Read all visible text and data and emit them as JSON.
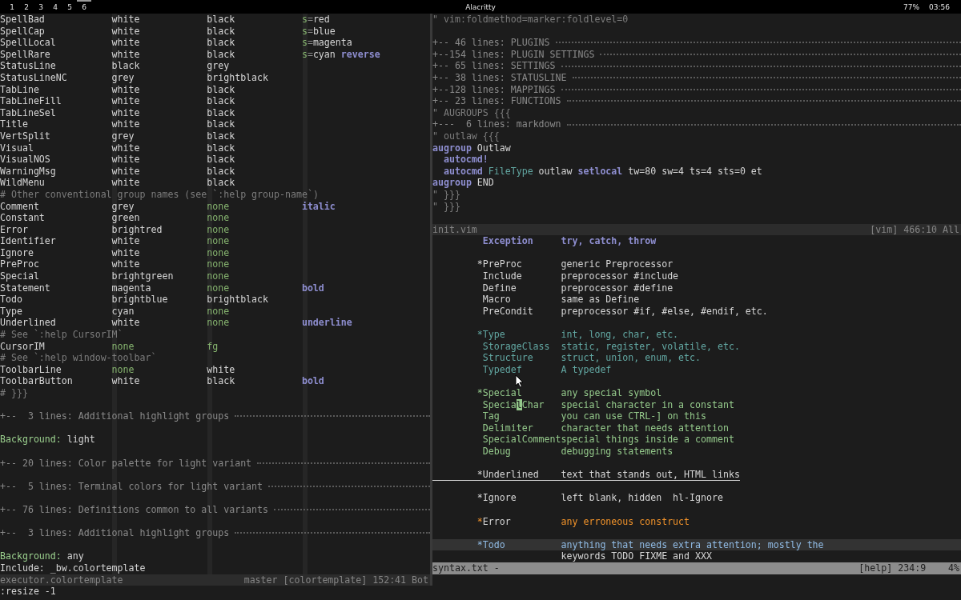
{
  "top_bar": {
    "workspaces": [
      {
        "label": "1",
        "selected": false
      },
      {
        "label": "2",
        "selected": false
      },
      {
        "label": "3",
        "selected": false
      },
      {
        "label": "4",
        "selected": false
      },
      {
        "label": "5",
        "selected": false
      },
      {
        "label": "6",
        "selected": true
      }
    ],
    "title": "Alacritty",
    "battery": "77%",
    "clock": "03:56"
  },
  "left_pane": {
    "lines": [
      {
        "kind": "entry",
        "cells": [
          [
            {
              "text": "SpellBad",
              "kind": "normal"
            }
          ],
          [
            {
              "text": "white",
              "kind": "normal"
            }
          ],
          [
            {
              "text": "black",
              "kind": "normal"
            }
          ],
          [
            {
              "text": "s",
              "kind": "constant"
            },
            {
              "text": "=",
              "kind": "operator",
              "attached": true
            },
            {
              "text": "red",
              "kind": "normal",
              "attached": true
            }
          ]
        ]
      },
      {
        "kind": "entry",
        "cells": [
          [
            {
              "text": "SpellCap",
              "kind": "normal"
            }
          ],
          [
            {
              "text": "white",
              "kind": "normal"
            }
          ],
          [
            {
              "text": "black",
              "kind": "normal"
            }
          ],
          [
            {
              "text": "s",
              "kind": "constant"
            },
            {
              "text": "=",
              "kind": "operator",
              "attached": true
            },
            {
              "text": "blue",
              "kind": "normal",
              "attached": true
            }
          ]
        ]
      },
      {
        "kind": "entry",
        "cells": [
          [
            {
              "text": "SpellLocal",
              "kind": "normal"
            }
          ],
          [
            {
              "text": "white",
              "kind": "normal"
            }
          ],
          [
            {
              "text": "black",
              "kind": "normal"
            }
          ],
          [
            {
              "text": "s",
              "kind": "constant"
            },
            {
              "text": "=",
              "kind": "operator",
              "attached": true
            },
            {
              "text": "magenta",
              "kind": "normal",
              "attached": true
            }
          ]
        ]
      },
      {
        "kind": "entry",
        "cells": [
          [
            {
              "text": "SpellRare",
              "kind": "normal"
            }
          ],
          [
            {
              "text": "white",
              "kind": "normal"
            }
          ],
          [
            {
              "text": "black",
              "kind": "normal"
            }
          ],
          [
            {
              "text": "s",
              "kind": "constant"
            },
            {
              "text": "=",
              "kind": "operator",
              "attached": true
            },
            {
              "text": "cyan",
              "kind": "normal",
              "attached": true
            },
            {
              "text": "reverse",
              "kind": "statement"
            }
          ]
        ]
      },
      {
        "kind": "entry",
        "cells": [
          [
            {
              "text": "StatusLine",
              "kind": "normal"
            }
          ],
          [
            {
              "text": "black",
              "kind": "normal"
            }
          ],
          [
            {
              "text": "grey",
              "kind": "normal"
            }
          ]
        ]
      },
      {
        "kind": "entry",
        "cells": [
          [
            {
              "text": "StatusLineNC",
              "kind": "normal"
            }
          ],
          [
            {
              "text": "grey",
              "kind": "normal"
            }
          ],
          [
            {
              "text": "brightblack",
              "kind": "normal"
            }
          ]
        ]
      },
      {
        "kind": "entry",
        "cells": [
          [
            {
              "text": "TabLine",
              "kind": "normal"
            }
          ],
          [
            {
              "text": "white",
              "kind": "normal"
            }
          ],
          [
            {
              "text": "black",
              "kind": "normal"
            }
          ]
        ]
      },
      {
        "kind": "entry",
        "cells": [
          [
            {
              "text": "TabLineFill",
              "kind": "normal"
            }
          ],
          [
            {
              "text": "white",
              "kind": "normal"
            }
          ],
          [
            {
              "text": "black",
              "kind": "normal"
            }
          ]
        ]
      },
      {
        "kind": "entry",
        "cells": [
          [
            {
              "text": "TabLineSel",
              "kind": "normal"
            }
          ],
          [
            {
              "text": "white",
              "kind": "normal"
            }
          ],
          [
            {
              "text": "black",
              "kind": "normal"
            }
          ]
        ]
      },
      {
        "kind": "entry",
        "cells": [
          [
            {
              "text": "Title",
              "kind": "normal"
            }
          ],
          [
            {
              "text": "white",
              "kind": "normal"
            }
          ],
          [
            {
              "text": "black",
              "kind": "normal"
            }
          ]
        ]
      },
      {
        "kind": "entry",
        "cells": [
          [
            {
              "text": "VertSplit",
              "kind": "normal"
            }
          ],
          [
            {
              "text": "grey",
              "kind": "normal"
            }
          ],
          [
            {
              "text": "black",
              "kind": "normal"
            }
          ]
        ]
      },
      {
        "kind": "entry",
        "cells": [
          [
            {
              "text": "Visual",
              "kind": "normal"
            }
          ],
          [
            {
              "text": "white",
              "kind": "normal"
            }
          ],
          [
            {
              "text": "black",
              "kind": "normal"
            }
          ]
        ]
      },
      {
        "kind": "entry",
        "cells": [
          [
            {
              "text": "VisualNOS",
              "kind": "normal"
            }
          ],
          [
            {
              "text": "white",
              "kind": "normal"
            }
          ],
          [
            {
              "text": "black",
              "kind": "normal"
            }
          ]
        ]
      },
      {
        "kind": "entry",
        "cells": [
          [
            {
              "text": "WarningMsg",
              "kind": "normal"
            }
          ],
          [
            {
              "text": "white",
              "kind": "normal"
            }
          ],
          [
            {
              "text": "black",
              "kind": "normal"
            }
          ]
        ]
      },
      {
        "kind": "entry",
        "cells": [
          [
            {
              "text": "WildMenu",
              "kind": "normal"
            }
          ],
          [
            {
              "text": "white",
              "kind": "normal"
            }
          ],
          [
            {
              "text": "black",
              "kind": "normal"
            }
          ]
        ]
      },
      {
        "kind": "comment",
        "text": "# Other conventional group names (see `:help group-name`)"
      },
      {
        "kind": "entry",
        "cells": [
          [
            {
              "text": "Comment",
              "kind": "normal"
            }
          ],
          [
            {
              "text": "grey",
              "kind": "normal"
            }
          ],
          [
            {
              "text": "none",
              "kind": "constant"
            }
          ],
          [
            {
              "text": "italic",
              "kind": "statement"
            }
          ]
        ]
      },
      {
        "kind": "entry",
        "cells": [
          [
            {
              "text": "Constant",
              "kind": "normal"
            }
          ],
          [
            {
              "text": "green",
              "kind": "normal"
            }
          ],
          [
            {
              "text": "none",
              "kind": "constant"
            }
          ]
        ]
      },
      {
        "kind": "entry",
        "cells": [
          [
            {
              "text": "Error",
              "kind": "normal"
            }
          ],
          [
            {
              "text": "brightred",
              "kind": "normal"
            }
          ],
          [
            {
              "text": "none",
              "kind": "constant"
            }
          ]
        ]
      },
      {
        "kind": "entry",
        "cells": [
          [
            {
              "text": "Identifier",
              "kind": "normal"
            }
          ],
          [
            {
              "text": "white",
              "kind": "normal"
            }
          ],
          [
            {
              "text": "none",
              "kind": "constant"
            }
          ]
        ]
      },
      {
        "kind": "entry",
        "cells": [
          [
            {
              "text": "Ignore",
              "kind": "normal"
            }
          ],
          [
            {
              "text": "white",
              "kind": "normal"
            }
          ],
          [
            {
              "text": "none",
              "kind": "constant"
            }
          ]
        ]
      },
      {
        "kind": "entry",
        "cells": [
          [
            {
              "text": "PreProc",
              "kind": "normal"
            }
          ],
          [
            {
              "text": "white",
              "kind": "normal"
            }
          ],
          [
            {
              "text": "none",
              "kind": "constant"
            }
          ]
        ]
      },
      {
        "kind": "entry",
        "cells": [
          [
            {
              "text": "Special",
              "kind": "normal"
            }
          ],
          [
            {
              "text": "brightgreen",
              "kind": "normal"
            }
          ],
          [
            {
              "text": "none",
              "kind": "constant"
            }
          ]
        ]
      },
      {
        "kind": "entry",
        "cells": [
          [
            {
              "text": "Statement",
              "kind": "normal"
            }
          ],
          [
            {
              "text": "magenta",
              "kind": "normal"
            }
          ],
          [
            {
              "text": "none",
              "kind": "constant"
            }
          ],
          [
            {
              "text": "bold",
              "kind": "statement"
            }
          ]
        ]
      },
      {
        "kind": "entry",
        "cells": [
          [
            {
              "text": "Todo",
              "kind": "normal"
            }
          ],
          [
            {
              "text": "brightblue",
              "kind": "normal"
            }
          ],
          [
            {
              "text": "brightblack",
              "kind": "normal"
            }
          ]
        ]
      },
      {
        "kind": "entry",
        "cells": [
          [
            {
              "text": "Type",
              "kind": "normal"
            }
          ],
          [
            {
              "text": "cyan",
              "kind": "normal"
            }
          ],
          [
            {
              "text": "none",
              "kind": "constant"
            }
          ]
        ]
      },
      {
        "kind": "entry",
        "cells": [
          [
            {
              "text": "Underlined",
              "kind": "normal"
            }
          ],
          [
            {
              "text": "white",
              "kind": "normal"
            }
          ],
          [
            {
              "text": "none",
              "kind": "constant"
            }
          ],
          [
            {
              "text": "underline",
              "kind": "statement"
            }
          ]
        ]
      },
      {
        "kind": "comment",
        "text": "# See `:help CursorIM`"
      },
      {
        "kind": "entry",
        "cells": [
          [
            {
              "text": "CursorIM",
              "kind": "normal"
            }
          ],
          [
            {
              "text": "none",
              "kind": "constant"
            }
          ],
          [
            {
              "text": "fg",
              "kind": "constant"
            }
          ]
        ]
      },
      {
        "kind": "comment",
        "text": "# See `:help window-toolbar`"
      },
      {
        "kind": "entry",
        "cells": [
          [
            {
              "text": "ToolbarLine",
              "kind": "normal"
            }
          ],
          [
            {
              "text": "none",
              "kind": "constant"
            }
          ],
          [
            {
              "text": "white",
              "kind": "normal"
            }
          ]
        ]
      },
      {
        "kind": "entry",
        "cells": [
          [
            {
              "text": "ToolbarButton",
              "kind": "normal"
            }
          ],
          [
            {
              "text": "white",
              "kind": "normal"
            }
          ],
          [
            {
              "text": "black",
              "kind": "normal"
            }
          ],
          [
            {
              "text": "bold",
              "kind": "statement"
            }
          ]
        ]
      },
      {
        "kind": "comment",
        "text": "# }}}"
      },
      {
        "kind": "blank"
      },
      {
        "kind": "fold",
        "text": "+--  3 lines: Additional highlight groups"
      },
      {
        "kind": "blank"
      },
      {
        "kind": "setting",
        "key": "Background:",
        "value": "light"
      },
      {
        "kind": "blank"
      },
      {
        "kind": "fold",
        "text": "+-- 20 lines: Color palette for light variant"
      },
      {
        "kind": "blank"
      },
      {
        "kind": "fold",
        "text": "+--  5 lines: Terminal colors for light variant"
      },
      {
        "kind": "blank"
      },
      {
        "kind": "fold",
        "text": "+-- 76 lines: Definitions common to all variants"
      },
      {
        "kind": "blank"
      },
      {
        "kind": "fold",
        "text": "+--  3 lines: Additional highlight groups"
      },
      {
        "kind": "blank"
      },
      {
        "kind": "setting",
        "key": "Background:",
        "value": "any"
      },
      {
        "kind": "plain",
        "text": "Include: _bw.colortemplate"
      }
    ],
    "status_line": {
      "file": "executor.colortemplate",
      "info": "master [colortemplate] 152:41 Bot",
      "active": false
    }
  },
  "top_right_pane": {
    "lines": [
      {
        "kind": "comment",
        "text": "\" vim:foldmethod=marker:foldlevel=0"
      },
      {
        "kind": "blank"
      },
      {
        "kind": "fold",
        "text": "+-- 46 lines: PLUGINS"
      },
      {
        "kind": "fold",
        "text": "+--154 lines: PLUGIN SETTINGS"
      },
      {
        "kind": "fold",
        "text": "+-- 65 lines: SETTINGS"
      },
      {
        "kind": "fold",
        "text": "+-- 38 lines: STATUSLINE"
      },
      {
        "kind": "fold",
        "text": "+--128 lines: MAPPINGS"
      },
      {
        "kind": "fold",
        "text": "+-- 23 lines: FUNCTIONS"
      },
      {
        "kind": "comment",
        "text": "\" AUGROUPS {{{"
      },
      {
        "kind": "fold",
        "text": "+---  6 lines: markdown"
      },
      {
        "kind": "comment",
        "text": "\" outlaw {{{"
      },
      {
        "kind": "code",
        "tokens": [
          {
            "text": "augroup",
            "kind": "statement"
          },
          {
            "text": "Outlaw",
            "kind": "normal"
          }
        ],
        "children": [
          {
            "kind": "code",
            "tokens": [
              {
                "text": "autocmd!",
                "kind": "statement"
              }
            ]
          },
          {
            "kind": "code",
            "tokens": [
              {
                "text": "autocmd",
                "kind": "statement"
              },
              {
                "text": "FileType",
                "kind": "type"
              },
              {
                "text": "outlaw",
                "kind": "normal"
              },
              {
                "text": "setlocal",
                "kind": "statement"
              },
              {
                "text": "tw=80 sw=4 ts=4 sts=0 et",
                "kind": "normal"
              }
            ]
          }
        ]
      },
      {
        "kind": "code",
        "tokens": [
          {
            "text": "augroup",
            "kind": "statement"
          },
          {
            "text": "END",
            "kind": "normal"
          }
        ]
      },
      {
        "kind": "comment",
        "text": "\" }}}"
      },
      {
        "kind": "comment",
        "text": "\" }}}"
      },
      {
        "kind": "blank"
      }
    ],
    "status_line": {
      "file": "init.vim",
      "info": "[vim] 466:10 All",
      "active": false
    }
  },
  "bottom_right_pane": {
    "groups": [
      {
        "cursor_line": false,
        "underlined": false,
        "children": [
          {
            "tag": [
              {
                "text": "Exception",
                "kind": "statement"
              }
            ],
            "description": [
              {
                "text": "try, catch, throw",
                "kind": "statement"
              }
            ]
          }
        ]
      },
      {
        "cursor_line": false,
        "underlined": false,
        "tag": [
          {
            "text": "*PreProc",
            "kind": "normal"
          }
        ],
        "description": [
          {
            "text": "generic Preprocessor",
            "kind": "normal"
          }
        ],
        "children": [
          {
            "tag": [
              {
                "text": "Include",
                "kind": "normal"
              }
            ],
            "description": [
              {
                "text": "preprocessor #include",
                "kind": "normal"
              }
            ]
          },
          {
            "tag": [
              {
                "text": "Define",
                "kind": "normal"
              }
            ],
            "description": [
              {
                "text": "preprocessor #define",
                "kind": "normal"
              }
            ]
          },
          {
            "tag": [
              {
                "text": "Macro",
                "kind": "normal"
              }
            ],
            "description": [
              {
                "text": "same as Define",
                "kind": "normal"
              }
            ]
          },
          {
            "tag": [
              {
                "text": "PreCondit",
                "kind": "normal"
              }
            ],
            "description": [
              {
                "text": "preprocessor #if, #else, #endif, etc.",
                "kind": "normal"
              }
            ]
          }
        ]
      },
      {
        "cursor_line": false,
        "underlined": false,
        "tag": [
          {
            "text": "*Type",
            "kind": "type"
          }
        ],
        "description": [
          {
            "text": "int, long, char, etc.",
            "kind": "type"
          }
        ],
        "children": [
          {
            "tag": [
              {
                "text": "StorageClass",
                "kind": "type"
              }
            ],
            "description": [
              {
                "text": "static, register, volatile, etc.",
                "kind": "type"
              }
            ]
          },
          {
            "tag": [
              {
                "text": "Structure",
                "kind": "type"
              }
            ],
            "description": [
              {
                "text": "struct, union, enum, etc.",
                "kind": "type"
              }
            ]
          },
          {
            "tag": [
              {
                "text": "Typedef",
                "kind": "type"
              }
            ],
            "description": [
              {
                "text": "A typedef",
                "kind": "type"
              }
            ]
          }
        ]
      },
      {
        "cursor_line": false,
        "underlined": false,
        "tag": [
          {
            "text": "*Special",
            "kind": "special"
          }
        ],
        "description": [
          {
            "text": "any special symbol",
            "kind": "special"
          }
        ],
        "children": [
          {
            "tag": [
              {
                "text": "Specia",
                "kind": "special"
              },
              {
                "text": "l",
                "kind": "cursor"
              },
              {
                "text": "Char",
                "kind": "special"
              }
            ],
            "description": [
              {
                "text": "special character in a constant",
                "kind": "special"
              }
            ]
          },
          {
            "tag": [
              {
                "text": "Tag",
                "kind": "special"
              }
            ],
            "description": [
              {
                "text": "you can use CTRL-] on this",
                "kind": "special"
              }
            ]
          },
          {
            "tag": [
              {
                "text": "Delimiter",
                "kind": "special"
              }
            ],
            "description": [
              {
                "text": "character that needs attention",
                "kind": "special"
              }
            ]
          },
          {
            "tag": [
              {
                "text": "SpecialComment",
                "kind": "special"
              }
            ],
            "description": [
              {
                "text": "special things inside a comment",
                "kind": "special"
              }
            ]
          },
          {
            "tag": [
              {
                "text": "Debug",
                "kind": "special"
              }
            ],
            "description": [
              {
                "text": "debugging statements",
                "kind": "special"
              }
            ]
          }
        ]
      },
      {
        "cursor_line": false,
        "underlined": true,
        "tag": [
          {
            "text": "*Underlined",
            "kind": "normal"
          }
        ],
        "description": [
          {
            "text": "text that stands out, HTML links",
            "kind": "normal"
          }
        ]
      },
      {
        "cursor_line": false,
        "underlined": false,
        "tag": [
          {
            "text": "*Ignore",
            "kind": "normal"
          }
        ],
        "description": [
          {
            "text": "left blank, hidden  hl-Ignore",
            "kind": "normal"
          }
        ]
      },
      {
        "cursor_line": false,
        "underlined": false,
        "tag": [
          {
            "text": "*",
            "kind": "error"
          },
          {
            "text": "Error",
            "kind": "normal"
          }
        ],
        "description": [
          {
            "text": "any erroneous construct",
            "kind": "error"
          }
        ]
      },
      {
        "cursor_line": true,
        "underlined": false,
        "tag": [
          {
            "text": "*Todo",
            "kind": "todo"
          }
        ],
        "description": [
          {
            "text": "anything that needs extra attention; mostly the",
            "kind": "todo"
          }
        ],
        "continuation": [
          {
            "text": "keywords TODO FIXME and XXX",
            "kind": "normal"
          }
        ]
      }
    ],
    "status_line": {
      "file": "syntax.txt -",
      "info": "[help] 234:9",
      "percent": "4%",
      "active": true
    }
  },
  "command_line": ":resize -1"
}
